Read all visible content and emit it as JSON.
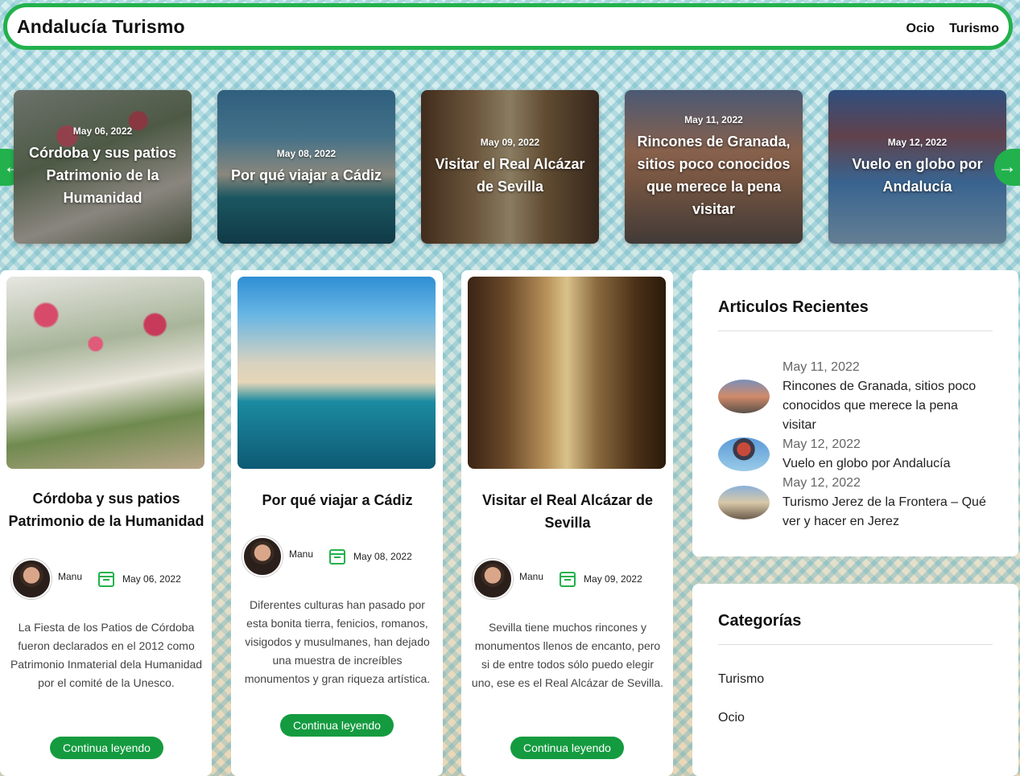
{
  "header": {
    "brand": "Andalucía Turismo",
    "nav": [
      "Ocio",
      "Turismo"
    ]
  },
  "slider": {
    "slides": [
      {
        "date": "May 06, 2022",
        "title": "Córdoba y sus patios Patrimonio de la Humanidad"
      },
      {
        "date": "May 08, 2022",
        "title": "Por qué viajar a Cádiz"
      },
      {
        "date": "May 09, 2022",
        "title": "Visitar el Real Alcázar de Sevilla"
      },
      {
        "date": "May 11, 2022",
        "title": "Rincones de Granada, sitios poco conocidos que merece la pena visitar"
      },
      {
        "date": "May 12, 2022",
        "title": "Vuelo en globo por Andalucía"
      }
    ]
  },
  "posts": [
    {
      "title": "Córdoba y sus patios Patrimonio de la Humanidad",
      "author": "Manu",
      "date": "May 06, 2022",
      "excerpt": "La Fiesta de los Patios de Córdoba fueron declarados en el 2012 como Patrimonio Inmaterial dela Humanidad por el comité de la Unesco.",
      "button": "Continua leyendo"
    },
    {
      "title": "Por qué viajar a Cádiz",
      "author": "Manu",
      "date": "May 08, 2022",
      "excerpt": "Diferentes culturas han pasado por esta bonita tierra, fenicios, romanos, visigodos y musulmanes, han dejado una muestra de increíbles monumentos y gran riqueza artística.",
      "button": "Continua leyendo"
    },
    {
      "title": "Visitar el Real Alcázar de Sevilla",
      "author": "Manu",
      "date": "May 09, 2022",
      "excerpt": "Sevilla tiene muchos rincones y monumentos llenos de encanto, pero si de entre todos sólo puedo elegir uno, ese es el Real Alcázar de Sevilla.",
      "button": "Continua leyendo"
    }
  ],
  "sidebar": {
    "recent": {
      "heading": "Articulos Recientes",
      "items": [
        {
          "date": "May 11, 2022",
          "title": "Rincones de Granada, sitios poco conocidos que merece la pena visitar"
        },
        {
          "date": "May 12, 2022",
          "title": "Vuelo en globo por Andalucía"
        },
        {
          "date": "May 12, 2022",
          "title": "Turismo Jerez de la Frontera – Qué ver y hacer en Jerez"
        }
      ]
    },
    "categories": {
      "heading": "Categorías",
      "items": [
        "Turismo",
        "Ocio"
      ]
    }
  },
  "colors": {
    "accent": "#22b14c",
    "button": "#149b40"
  }
}
